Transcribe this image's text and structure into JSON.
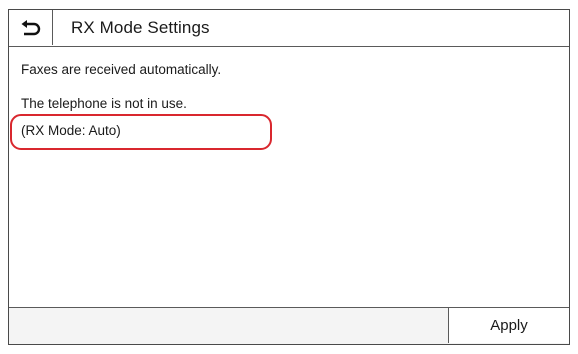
{
  "header": {
    "back_icon": "back-arrow-icon",
    "title": "RX Mode Settings"
  },
  "content": {
    "line1": "Faxes are received automatically.",
    "line2": "The telephone is not in use.",
    "mode_text": "(RX Mode: Auto)"
  },
  "footer": {
    "apply_label": "Apply"
  },
  "colors": {
    "highlight": "#d9272e",
    "border": "#4a4a4a"
  }
}
